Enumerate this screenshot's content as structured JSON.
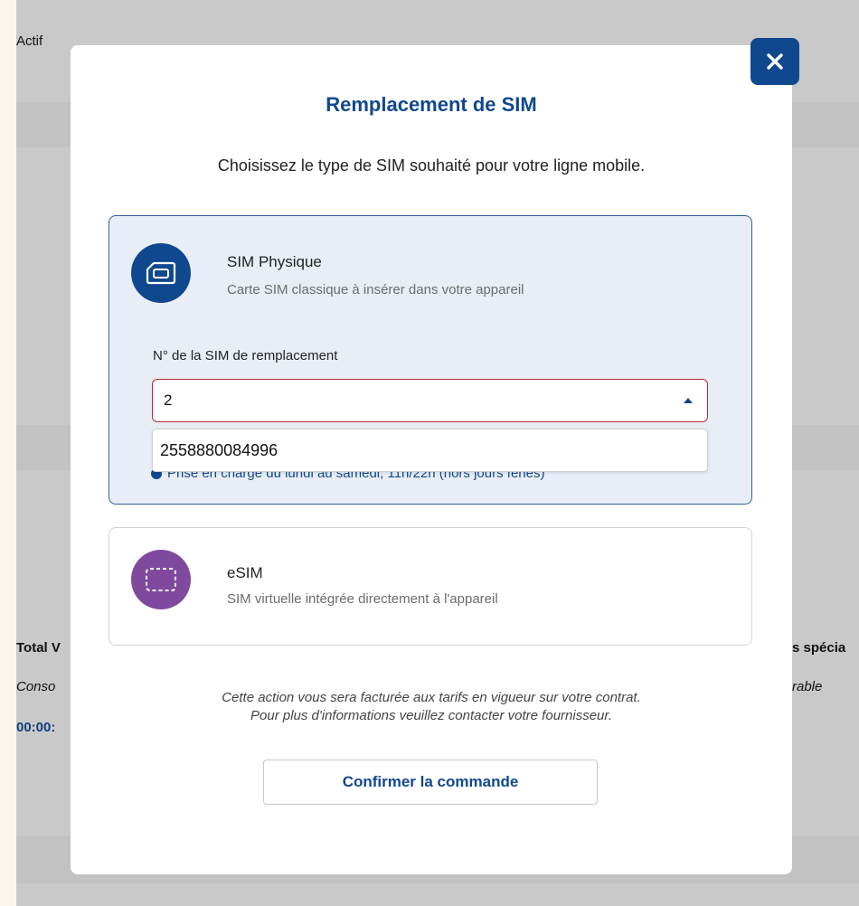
{
  "background": {
    "status_text": "Actif",
    "total_label": "Total V",
    "conso_label": "Conso",
    "time_value": "00:00:",
    "special_label": "s spécia",
    "rable_label": "rable"
  },
  "modal": {
    "title": "Remplacement de SIM",
    "subtitle": "Choisissez le type de SIM souhaité pour votre ligne mobile.",
    "close_icon": "close-icon",
    "options": [
      {
        "title": "SIM Physique",
        "description": "Carte SIM classique à insérer dans votre appareil",
        "icon": "sim-card-icon",
        "selected": true
      },
      {
        "title": "eSIM",
        "description": "SIM virtuelle intégrée directement à l'appareil",
        "icon": "esim-icon",
        "selected": false
      }
    ],
    "sim_field": {
      "label": "N° de la SIM de remplacement",
      "value": "2",
      "suggestion": "2558880084996"
    },
    "partial_note": "Prise en charge du lundi au samedi, 11h/22h (hors jours fériés)",
    "footer_line1": "Cette action vous sera facturée aux tarifs en vigueur sur votre contrat.",
    "footer_line2": "Pour plus d'informations veuillez contacter votre fournisseur.",
    "confirm_label": "Confirmer la commande"
  },
  "colors": {
    "primary": "#10488f",
    "esim_purple": "#7f4a9e",
    "error_border": "#c0282d",
    "selected_card_bg": "#e9eef6"
  }
}
